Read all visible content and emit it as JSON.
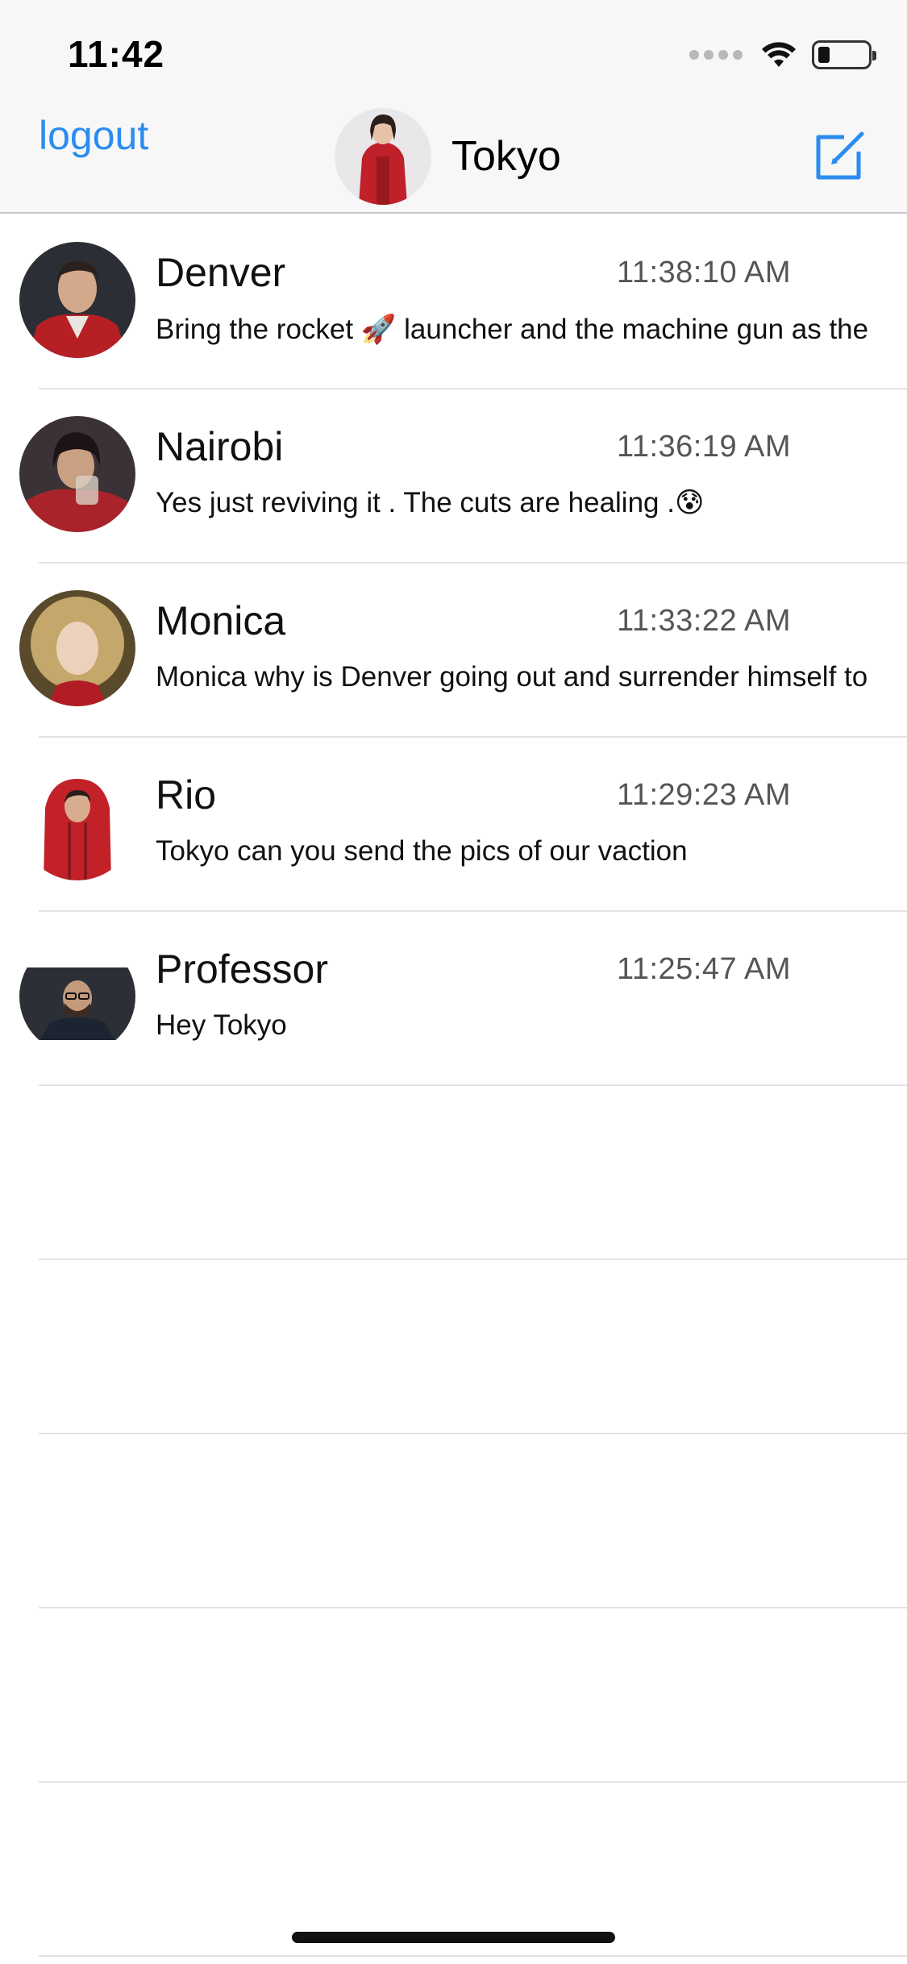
{
  "status_bar": {
    "time": "11:42",
    "icons": [
      "signal-icon",
      "wifi-icon",
      "battery-icon"
    ]
  },
  "nav": {
    "logout_label": "logout",
    "title": "Tokyo",
    "compose_icon": "compose-icon",
    "accent": "#2b8cf0"
  },
  "conversations": [
    {
      "name": "Denver",
      "time": "11:38:10 AM",
      "message": "Bring the rocket 🚀 launcher and the machine gun as the"
    },
    {
      "name": "Nairobi",
      "time": "11:36:19 AM",
      "message": "Yes just reviving it . The cuts are healing .😰"
    },
    {
      "name": "Monica",
      "time": "11:33:22 AM",
      "message": "Monica why is Denver going out and surrender himself to"
    },
    {
      "name": "Rio",
      "time": "11:29:23 AM",
      "message": "Tokyo can you send the pics of our vaction"
    },
    {
      "name": "Professor",
      "time": "11:25:47 AM",
      "message": "Hey Tokyo"
    }
  ]
}
